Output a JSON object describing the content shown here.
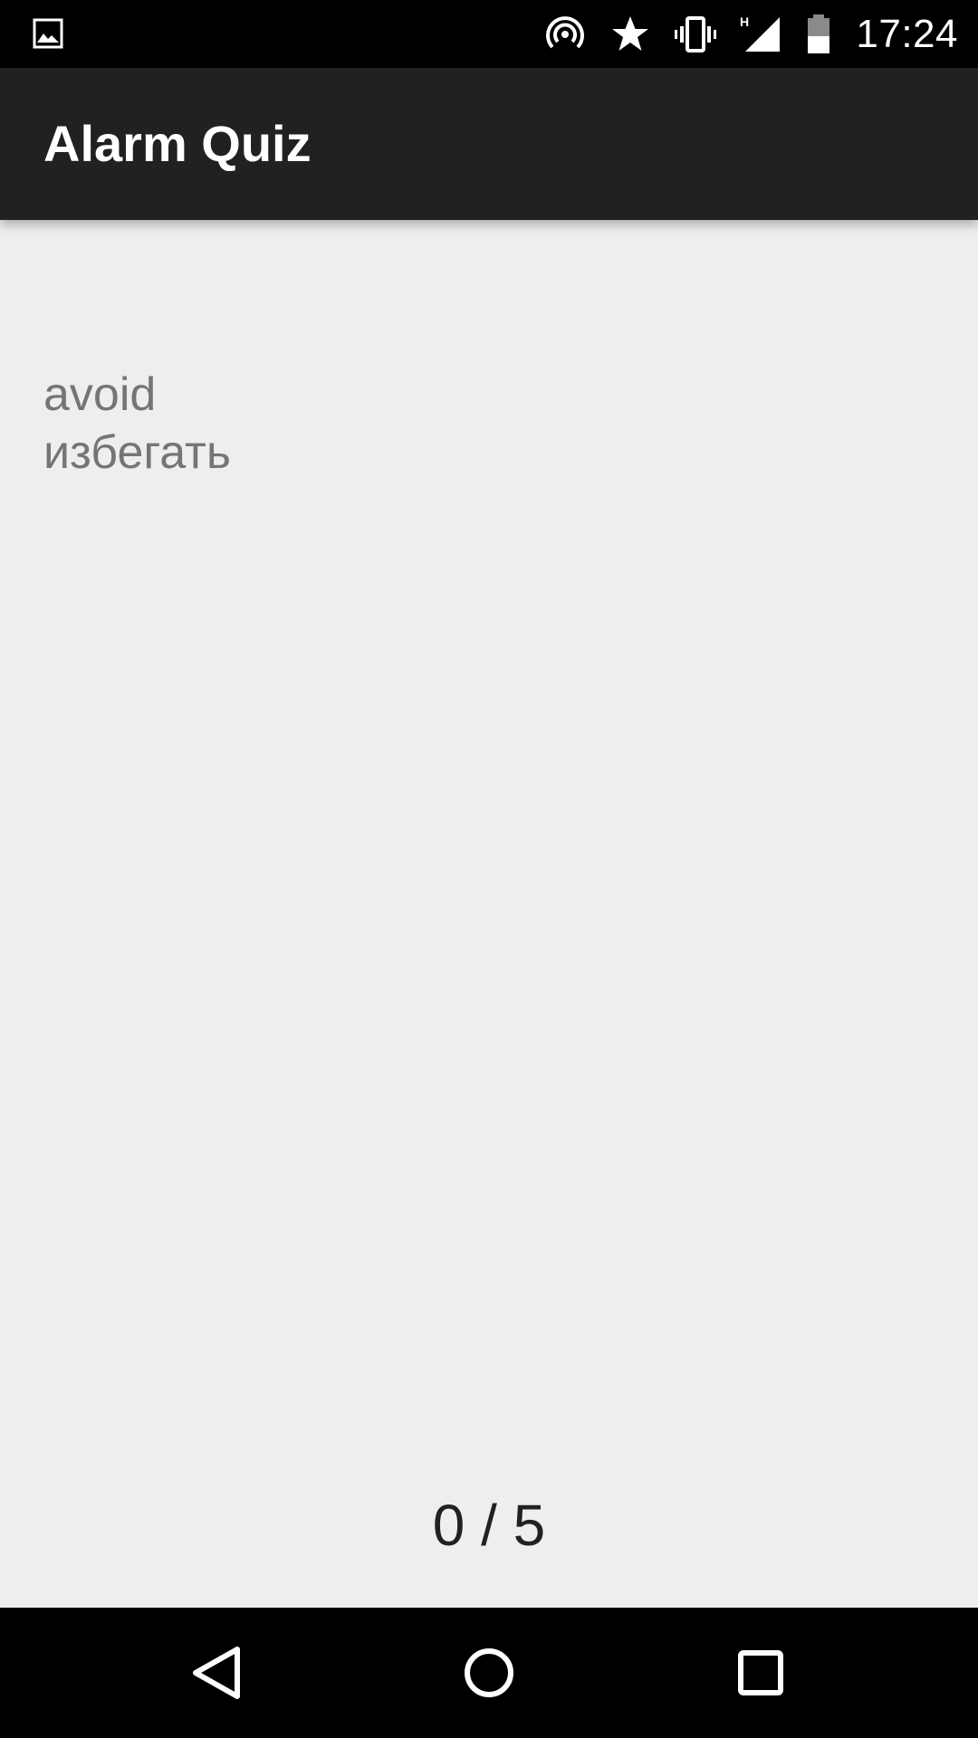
{
  "status_bar": {
    "time": "17:24",
    "network_type": "H",
    "left_icon": "gallery-notification-icon",
    "icons": [
      "hotspot-icon",
      "star-icon",
      "vibrate-icon",
      "signal-icon",
      "battery-icon"
    ],
    "battery_level": 0.5
  },
  "app_bar": {
    "title": "Alarm Quiz",
    "background": "#212121"
  },
  "content": {
    "word": "avoid",
    "translation": "избегать",
    "progress": "0 / 5"
  },
  "nav_bar": {
    "icons": [
      "back-icon",
      "home-icon",
      "recents-icon"
    ]
  },
  "colors": {
    "background": "#eeeeee",
    "text_secondary": "#757575",
    "text_primary": "#212121"
  }
}
